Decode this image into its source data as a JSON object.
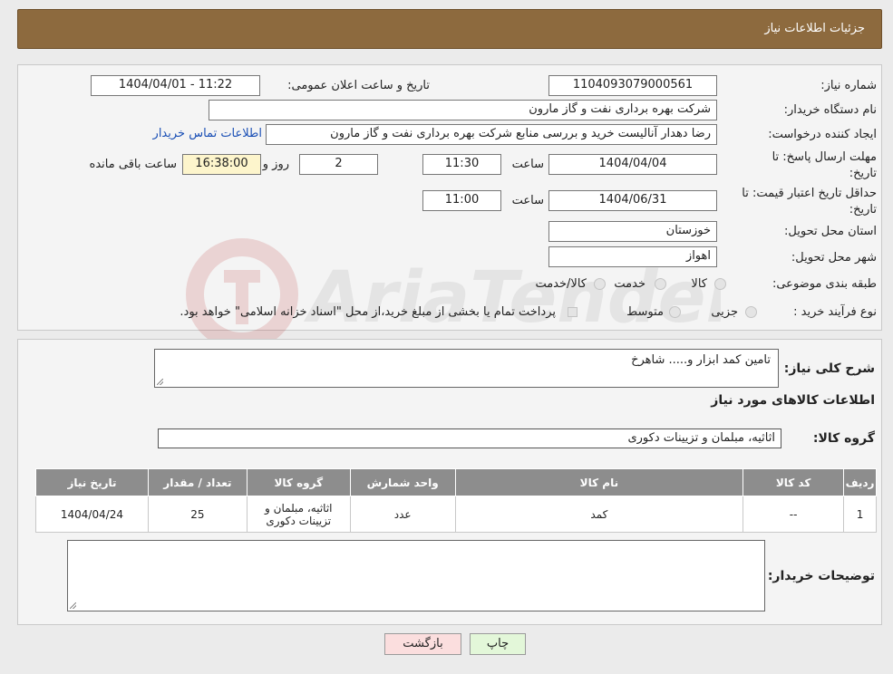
{
  "header": {
    "title": "جزئیات اطلاعات نیاز"
  },
  "details": {
    "need_number_label": "شماره نیاز:",
    "need_number": "1104093079000561",
    "announce_label": "تاریخ و ساعت اعلان عمومی:",
    "announce_value": "1404/04/01 - 11:22",
    "buyer_org_label": "نام دستگاه خریدار:",
    "buyer_org": "شرکت بهره برداری نفت و گاز مارون",
    "requester_label": "ایجاد کننده درخواست:",
    "requester": "رضا دهدار آنالیست خرید و بررسی منابع شرکت بهره برداری نفت و گاز مارون",
    "contact_link": "اطلاعات تماس خریدار",
    "deadline_label_1": "مهلت ارسال پاسخ: تا",
    "deadline_label_2": "تاریخ:",
    "deadline_date": "1404/04/04",
    "time_label": "ساعت",
    "deadline_time": "11:30",
    "days_value": "2",
    "days_label": "روز و",
    "remaining_time": "16:38:00",
    "remaining_label": "ساعت باقی مانده",
    "validity_label_1": "حداقل تاریخ اعتبار قیمت: تا",
    "validity_label_2": "تاریخ:",
    "validity_date": "1404/06/31",
    "validity_time": "11:00",
    "province_label": "استان محل تحویل:",
    "province": "خوزستان",
    "city_label": "شهر محل تحویل:",
    "city": "اهواز",
    "category_label": "طبقه بندی موضوعی:",
    "category_options": [
      "کالا",
      "خدمت",
      "کالا/خدمت"
    ],
    "process_label": "نوع فرآیند خرید :",
    "process_options": [
      "جزیی",
      "متوسط"
    ],
    "payment_note": "پرداخت تمام یا بخشی از مبلغ خرید،از محل \"اسناد خزانه اسلامی\" خواهد بود."
  },
  "summary": {
    "description_label": "شرح کلی نیاز:",
    "description": "تامین کمد ابزار و..... شاهرخ",
    "items_heading": "اطلاعات کالاهای مورد نیاز",
    "group_label": "گروه کالا:",
    "group_value": "اثاثیه، مبلمان و تزیینات دکوری",
    "table": {
      "headers": [
        "ردیف",
        "کد کالا",
        "نام کالا",
        "واحد شمارش",
        "گروه کالا",
        "تعداد / مقدار",
        "تاریخ نیاز"
      ],
      "rows": [
        [
          "1",
          "--",
          "کمد",
          "عدد",
          "اثاثیه، مبلمان و تزیینات دکوری",
          "25",
          "1404/04/24"
        ]
      ]
    },
    "buyer_notes_label": "توضیحات خریدار:",
    "buyer_notes": ""
  },
  "buttons": {
    "print": "چاپ",
    "back": "بازگشت"
  },
  "watermark": {
    "text": "AriaTender.neT"
  },
  "colors": {
    "header_bg": "#8d6a3e",
    "back_button_bg": "#fbdede",
    "print_button_bg": "#e3f7d9",
    "remaining_bg": "#fdf5cc",
    "link": "#1a4fb5"
  }
}
